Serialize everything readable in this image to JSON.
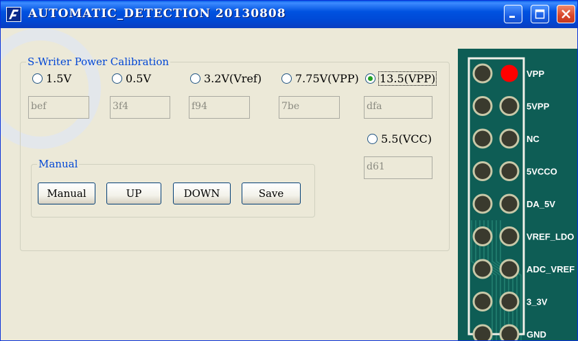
{
  "window": {
    "title": "AUTOMATIC_DETECTION 20130808",
    "controls": [
      "minimize-icon",
      "maximize-icon",
      "close-icon"
    ]
  },
  "power_group": {
    "legend": "S-Writer Power Calibration",
    "options": [
      {
        "label": "1.5V",
        "value": "bef",
        "checked": false
      },
      {
        "label": "0.5V",
        "value": "3f4",
        "checked": false
      },
      {
        "label": "3.2V(Vref)",
        "value": "f94",
        "checked": false
      },
      {
        "label": "7.75V(VPP)",
        "value": "7be",
        "checked": false
      },
      {
        "label": "13.5(VPP)",
        "value": "dfa",
        "checked": true
      },
      {
        "label": "5.5(VCC)",
        "value": "d61",
        "checked": false
      }
    ]
  },
  "manual_group": {
    "legend": "Manual",
    "buttons": {
      "manual": "Manual",
      "up": "UP",
      "down": "DOWN",
      "save": "Save"
    }
  },
  "board": {
    "pin_labels": [
      "VPP",
      "5VPP",
      "NC",
      "5VCCO",
      "DA_5V",
      "VREF_LDO",
      "ADC_VREF",
      "3_3V",
      "GND"
    ],
    "highlight_color": "#ff0000"
  },
  "colors": {
    "titlebar": "#0052e0",
    "legend": "#0046d5",
    "face": "#ece9d8"
  }
}
